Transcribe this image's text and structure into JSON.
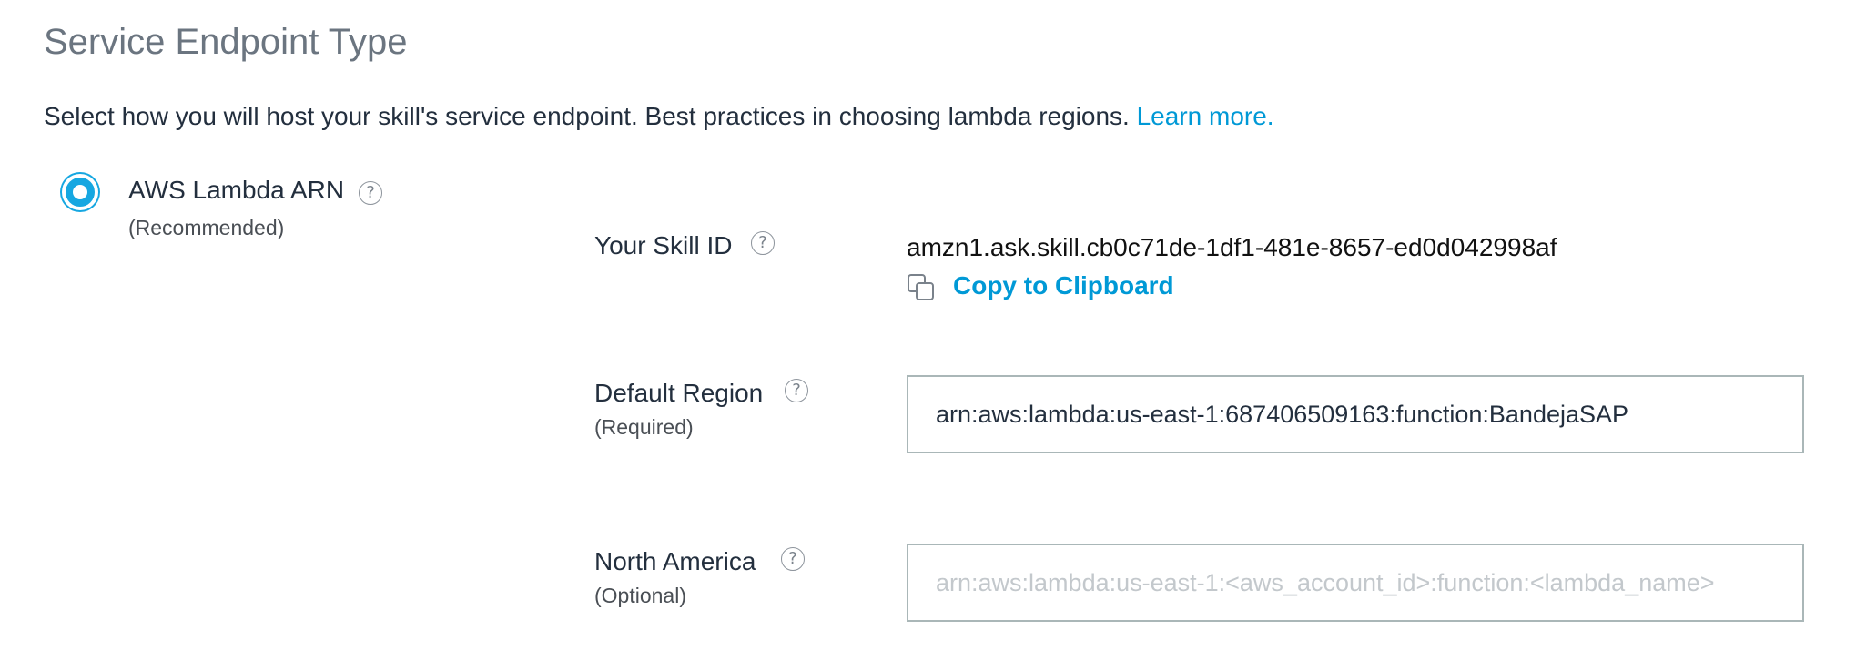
{
  "section": {
    "title": "Service Endpoint Type",
    "description": "Select how you will host your skill's service endpoint. Best practices in choosing lambda regions. ",
    "learn_more": "Learn more."
  },
  "endpoint_option": {
    "label": "AWS Lambda ARN",
    "note": "(Recommended)",
    "help_glyph": "?",
    "selected": true
  },
  "skill_id": {
    "label": "Your Skill ID",
    "value": "amzn1.ask.skill.cb0c71de-1df1-481e-8657-ed0d042998af",
    "copy_label": "Copy to Clipboard",
    "help_glyph": "?"
  },
  "default_region": {
    "label": "Default Region",
    "note": "(Required)",
    "value": "arn:aws:lambda:us-east-1:687406509163:function:BandejaSAP",
    "help_glyph": "?"
  },
  "north_america": {
    "label": "North America",
    "note": "(Optional)",
    "value": "",
    "placeholder": "arn:aws:lambda:us-east-1:<aws_account_id>:function:<lambda_name>",
    "help_glyph": "?"
  },
  "icons": {
    "help": "question-circle-icon",
    "copy": "copy-icon"
  },
  "colors": {
    "accent": "#16a7e1",
    "link": "#0099d6",
    "title": "#6b7580",
    "input_border": "#aab7b8"
  }
}
